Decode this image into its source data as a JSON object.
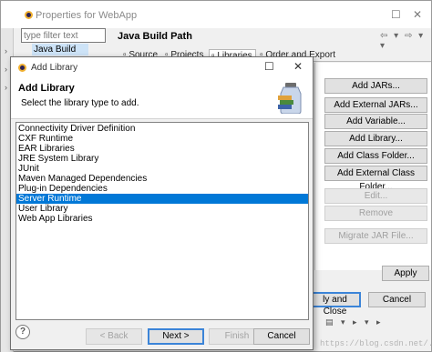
{
  "properties_window": {
    "title": "Properties for WebApp",
    "controls": {
      "minimize": "—",
      "maximize": "☐",
      "close": "✕"
    },
    "filter": {
      "placeholder": "type filter text",
      "value": ""
    },
    "tree": {
      "selected_item": "Java Build Path"
    },
    "page_title": "Java Build Path",
    "nav_arrows": "⇦ ▾ ⇨ ▾ ▾",
    "tabs": [
      {
        "label": "Source",
        "active": false
      },
      {
        "label": "Projects",
        "active": false
      },
      {
        "label": "Libraries",
        "active": true
      },
      {
        "label": "Order and Export",
        "active": false
      }
    ],
    "side_buttons": [
      {
        "label": "Add JARs...",
        "enabled": true
      },
      {
        "label": "Add External JARs...",
        "enabled": true
      },
      {
        "label": "Add Variable...",
        "enabled": true
      },
      {
        "label": "Add Library...",
        "enabled": true
      },
      {
        "label": "Add Class Folder...",
        "enabled": true
      },
      {
        "label": "Add External Class Folder...",
        "enabled": true
      },
      {
        "label": "Edit...",
        "enabled": false
      },
      {
        "label": "Remove",
        "enabled": false
      },
      {
        "label": "Migrate JAR File...",
        "enabled": false
      }
    ],
    "apply_label": "Apply",
    "apply_and_close_label": "ly and Close",
    "cancel_label": "Cancel",
    "watermark": "https://blog.csdn.net/..."
  },
  "dialog": {
    "title": "Add Library",
    "controls": {
      "maximize": "☐",
      "close": "✕"
    },
    "header_title": "Add Library",
    "header_subtitle": "Select the library type to add.",
    "library_types": [
      "Connectivity Driver Definition",
      "CXF Runtime",
      "EAR Libraries",
      "JRE System Library",
      "JUnit",
      "Maven Managed Dependencies",
      "Plug-in Dependencies",
      "Server Runtime",
      "User Library",
      "Web App Libraries"
    ],
    "selected_library": "Server Runtime",
    "help_label": "?",
    "buttons": {
      "back": "< Back",
      "next": "Next >",
      "finish": "Finish",
      "cancel": "Cancel"
    }
  },
  "colors": {
    "selection": "#0078d7",
    "default_button_border": "#3b84d8",
    "tree_selection": "#cde3f7"
  }
}
